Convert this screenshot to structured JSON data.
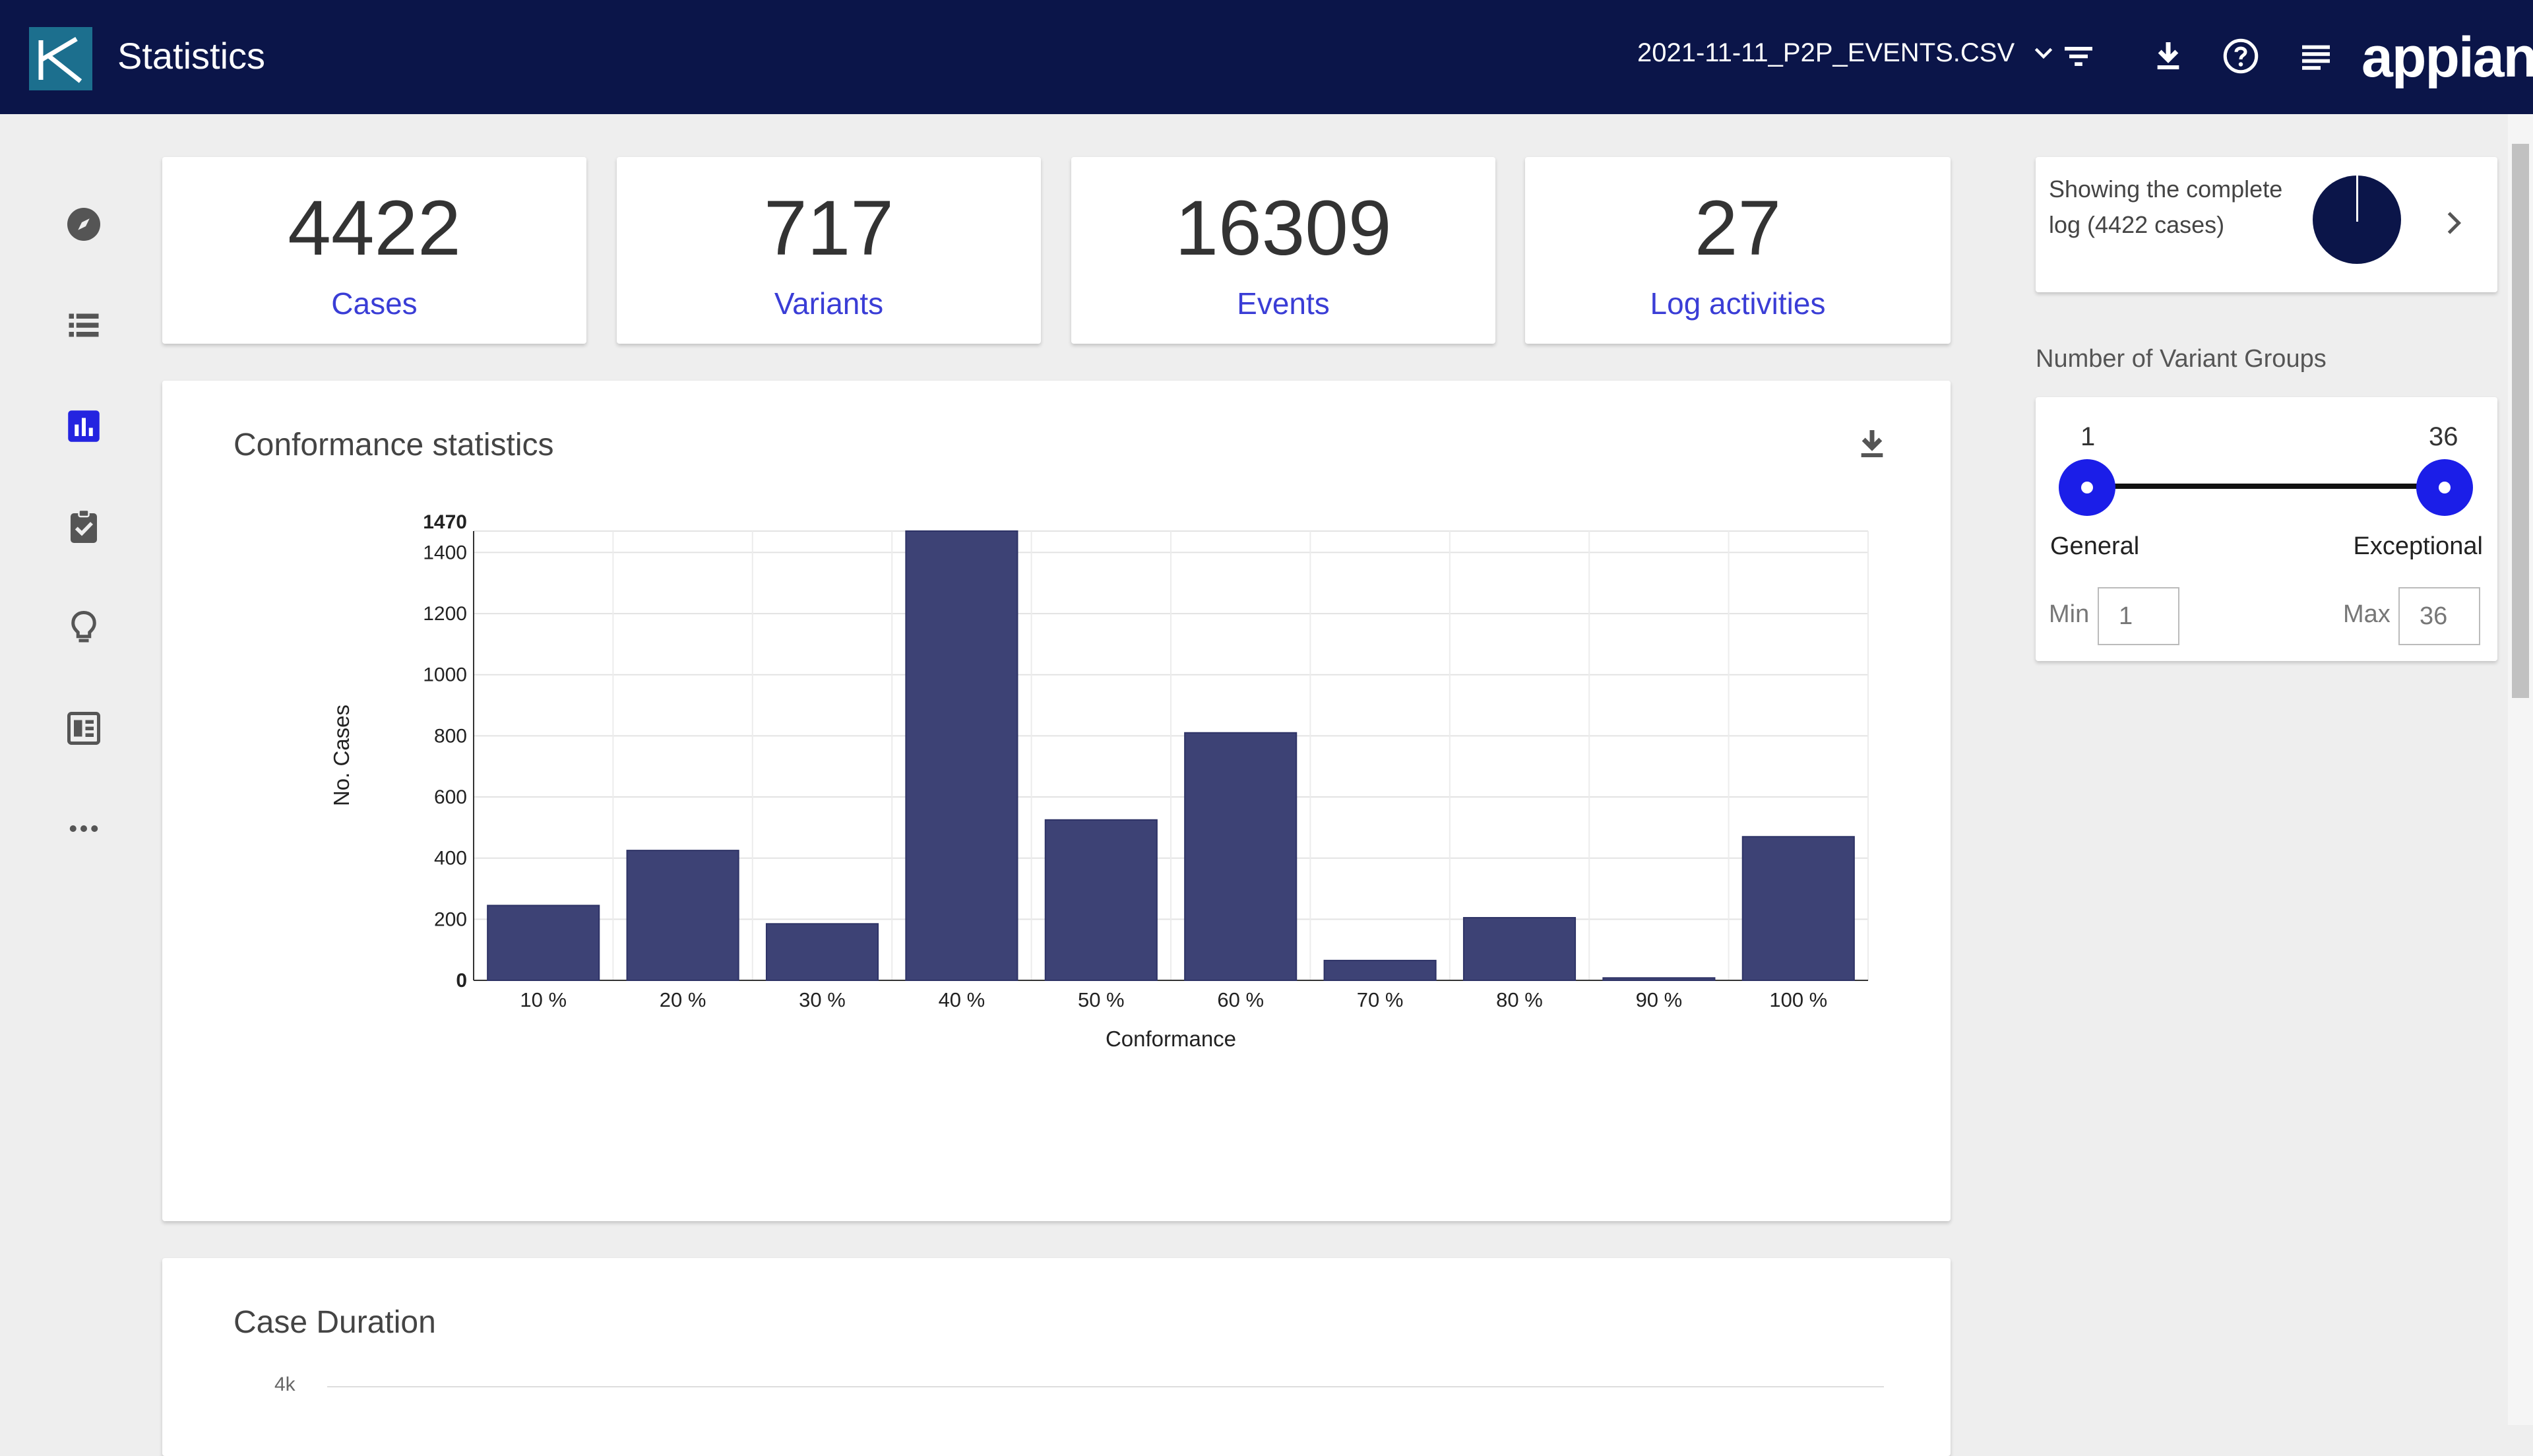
{
  "header": {
    "title": "Statistics",
    "file_name": "2021-11-11_P2P_EVENTS.CSV",
    "brand": "appian"
  },
  "metrics": [
    {
      "value": "4422",
      "label": "Cases"
    },
    {
      "value": "717",
      "label": "Variants"
    },
    {
      "value": "16309",
      "label": "Events"
    },
    {
      "value": "27",
      "label": "Log activities"
    }
  ],
  "conformance": {
    "title": "Conformance statistics"
  },
  "case_duration": {
    "title": "Case Duration",
    "tick": "4k"
  },
  "log_summary": {
    "text": "Showing the complete log (4422 cases)"
  },
  "variant_groups": {
    "label": "Number of Variant Groups",
    "min_value": "1",
    "max_value": "36",
    "left_label": "General",
    "right_label": "Exceptional",
    "min_label": "Min",
    "max_label": "Max",
    "min_input": "1",
    "max_input": "36"
  },
  "colors": {
    "header_bg": "#0b1549",
    "accent": "#3a3dd6",
    "bar": "#3d4275"
  },
  "chart_data": {
    "type": "bar",
    "title": "Conformance statistics",
    "xlabel": "Conformance",
    "ylabel": "No. Cases",
    "categories": [
      "10 %",
      "20 %",
      "30 %",
      "40 %",
      "50 %",
      "60 %",
      "70 %",
      "80 %",
      "90 %",
      "100 %"
    ],
    "values": [
      245,
      425,
      185,
      1470,
      525,
      810,
      65,
      205,
      8,
      470
    ],
    "ylim": [
      0,
      1470
    ],
    "yticks": [
      0,
      200,
      400,
      600,
      800,
      1000,
      1200,
      1400,
      1470
    ],
    "grid": true
  }
}
